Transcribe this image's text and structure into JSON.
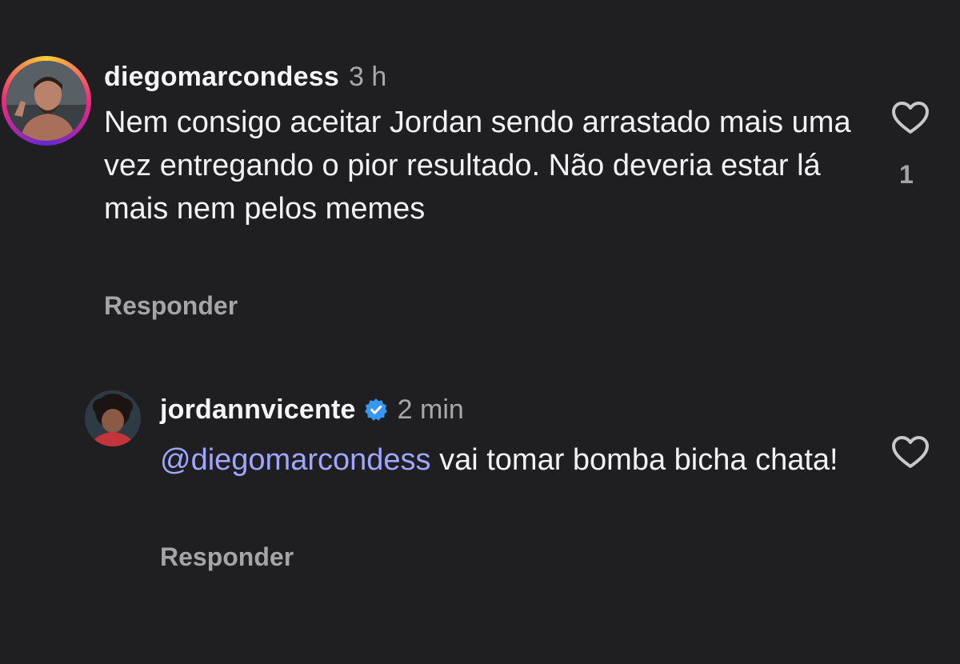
{
  "comments": [
    {
      "username": "diegomarcondess",
      "time": "3 h",
      "text": "Nem consigo aceitar Jordan sendo arrastado mais uma vez entregando o pior resultado. Não deveria estar lá mais nem pelos memes",
      "reply_label": "Responder",
      "like_count": "1",
      "avatar_icon": "user-avatar-with-story-ring",
      "liked": false
    },
    {
      "username": "jordannvicente",
      "verified": true,
      "time": "2 min",
      "mention": "@diegomarcondess",
      "text": " vai tomar bomba bicha chata!",
      "reply_label": "Responder",
      "avatar_icon": "user-avatar",
      "liked": false
    }
  ],
  "colors": {
    "background": "#1f1f22",
    "mention": "#9fa6ff",
    "verified": "#3897f0",
    "muted": "#a5a5a8"
  }
}
